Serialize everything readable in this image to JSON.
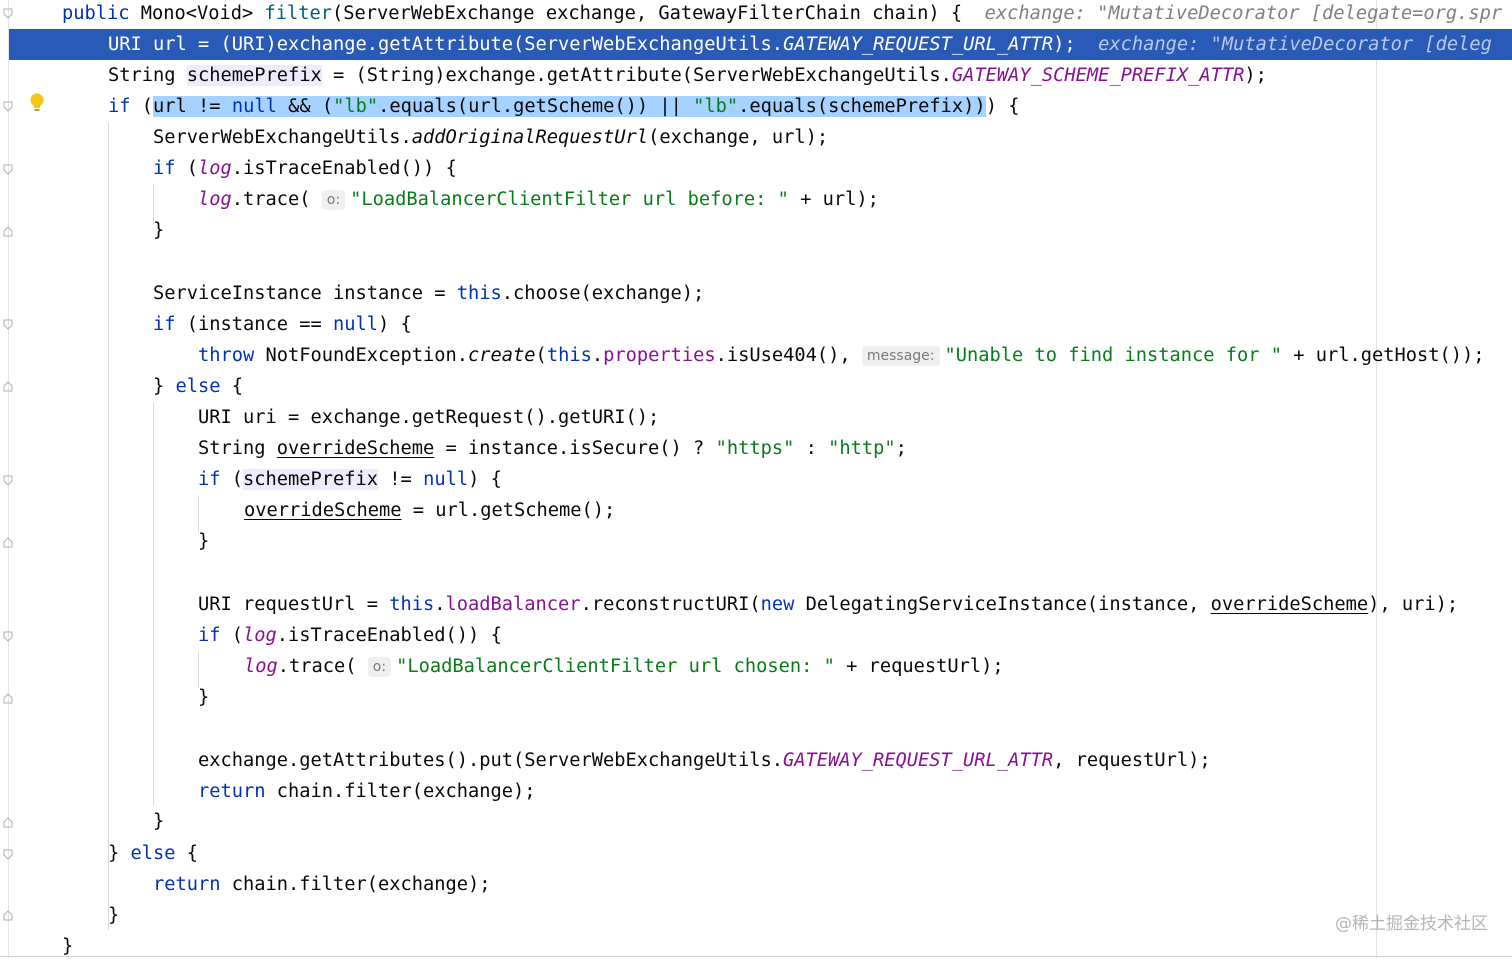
{
  "editor": {
    "lines": [
      [
        "",
        "public ",
        "Mono<Void> ",
        "filter",
        "(ServerWebExchange exchange, GatewayFilterChain chain) {  ",
        "exchange: \"MutativeDecorator [delegate=org.spr"
      ],
      [
        "URI url = (URI)exchange.getAttribute(ServerWebExchangeUtils.",
        "GATEWAY_REQUEST_URL_ATTR",
        ");  ",
        "exchange: \"MutativeDecorator [deleg"
      ],
      [
        "String ",
        "schemePrefix",
        " = (String)exchange.getAttribute(ServerWebExchangeUtils.",
        "GATEWAY_SCHEME_PREFIX_ATTR",
        ");"
      ],
      [
        "if ",
        "(",
        "url ",
        "!= ",
        "null",
        " && (",
        "\"lb\"",
        ".equals(url.getScheme()) || ",
        "\"lb\"",
        ".equals(schemePrefix))",
        ") {"
      ],
      [
        "ServerWebExchangeUtils.",
        "addOriginalRequestUrl",
        "(exchange, url);"
      ],
      [
        "if ",
        "(",
        "log",
        ".isTraceEnabled()) {"
      ],
      [
        "log",
        ".trace( ",
        "o:",
        "\"LoadBalancerClientFilter url before: \"",
        " + url);"
      ],
      [
        "}"
      ],
      [
        ""
      ],
      [
        "ServiceInstance instance = ",
        "this",
        ".choose(exchange);"
      ],
      [
        "if ",
        "(instance == ",
        "null",
        ") {"
      ],
      [
        "throw ",
        "NotFoundException.",
        "create",
        "(",
        "this",
        ".",
        "properties",
        ".isUse404(), ",
        "message:",
        "\"Unable to find instance for \"",
        " + url.getHost());"
      ],
      [
        "} ",
        "else",
        " {"
      ],
      [
        "URI uri = exchange.getRequest().getURI();"
      ],
      [
        "String ",
        "overrideScheme",
        " = instance.isSecure() ? ",
        "\"https\"",
        " : ",
        "\"http\"",
        ";"
      ],
      [
        "if ",
        "(",
        "schemePrefix",
        " != ",
        "null",
        ") {"
      ],
      [
        "overrideScheme",
        " = url.getScheme();"
      ],
      [
        "}"
      ],
      [
        ""
      ],
      [
        "URI requestUrl = ",
        "this",
        ".",
        "loadBalancer",
        ".reconstructURI(",
        "new ",
        "DelegatingServiceInstance(instance, ",
        "overrideScheme",
        "), uri);"
      ],
      [
        "if ",
        "(",
        "log",
        ".isTraceEnabled()) {"
      ],
      [
        "log",
        ".trace( ",
        "o:",
        "\"LoadBalancerClientFilter url chosen: \"",
        " + requestUrl);"
      ],
      [
        "}"
      ],
      [
        ""
      ],
      [
        "exchange.getAttributes().put(ServerWebExchangeUtils.",
        "GATEWAY_REQUEST_URL_ATTR",
        ", requestUrl);"
      ],
      [
        "return ",
        "chain.filter(exchange);"
      ],
      [
        "}"
      ],
      [
        "} ",
        "else",
        " {"
      ],
      [
        "return ",
        "chain.filter(exchange);"
      ],
      [
        "}"
      ],
      [
        "}"
      ]
    ]
  },
  "watermark": "@稀土掘金技术社区",
  "colors": {
    "keyword": "#0033b3",
    "string": "#067d17",
    "field": "#871094",
    "method_decl": "#00627a",
    "execution_line": "#2a5ab8",
    "selection": "#a6d2ff"
  },
  "icons": [
    "fold-marker-icon",
    "lightbulb-icon"
  ]
}
